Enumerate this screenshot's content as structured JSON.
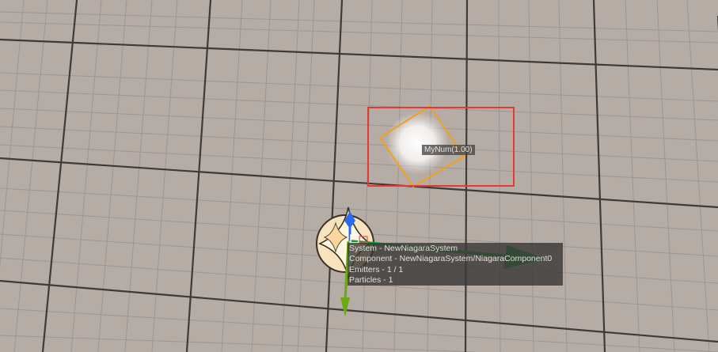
{
  "particle_label": "MyNum(1.00)",
  "stats": {
    "system": "System - NewNiagaraSystem",
    "component": "Component - NewNiagaraSystem/NiagaraComponent0",
    "emitters": "Emitters - 1 / 1",
    "particles": "Particles - 1"
  },
  "colors": {
    "floor": "#b5aca6",
    "grid_major": "#3d3a38",
    "grid_minor": "#9d958f",
    "highlight_rect": "#e53935",
    "particle_bounds": "#f0a020",
    "axis_x": "#1a9a3a",
    "axis_y": "#2a6cf0",
    "axis_z": "#6aaa10"
  },
  "icons": {
    "niagara_system": "sparkle-icon",
    "particle": "particle-sprite"
  }
}
